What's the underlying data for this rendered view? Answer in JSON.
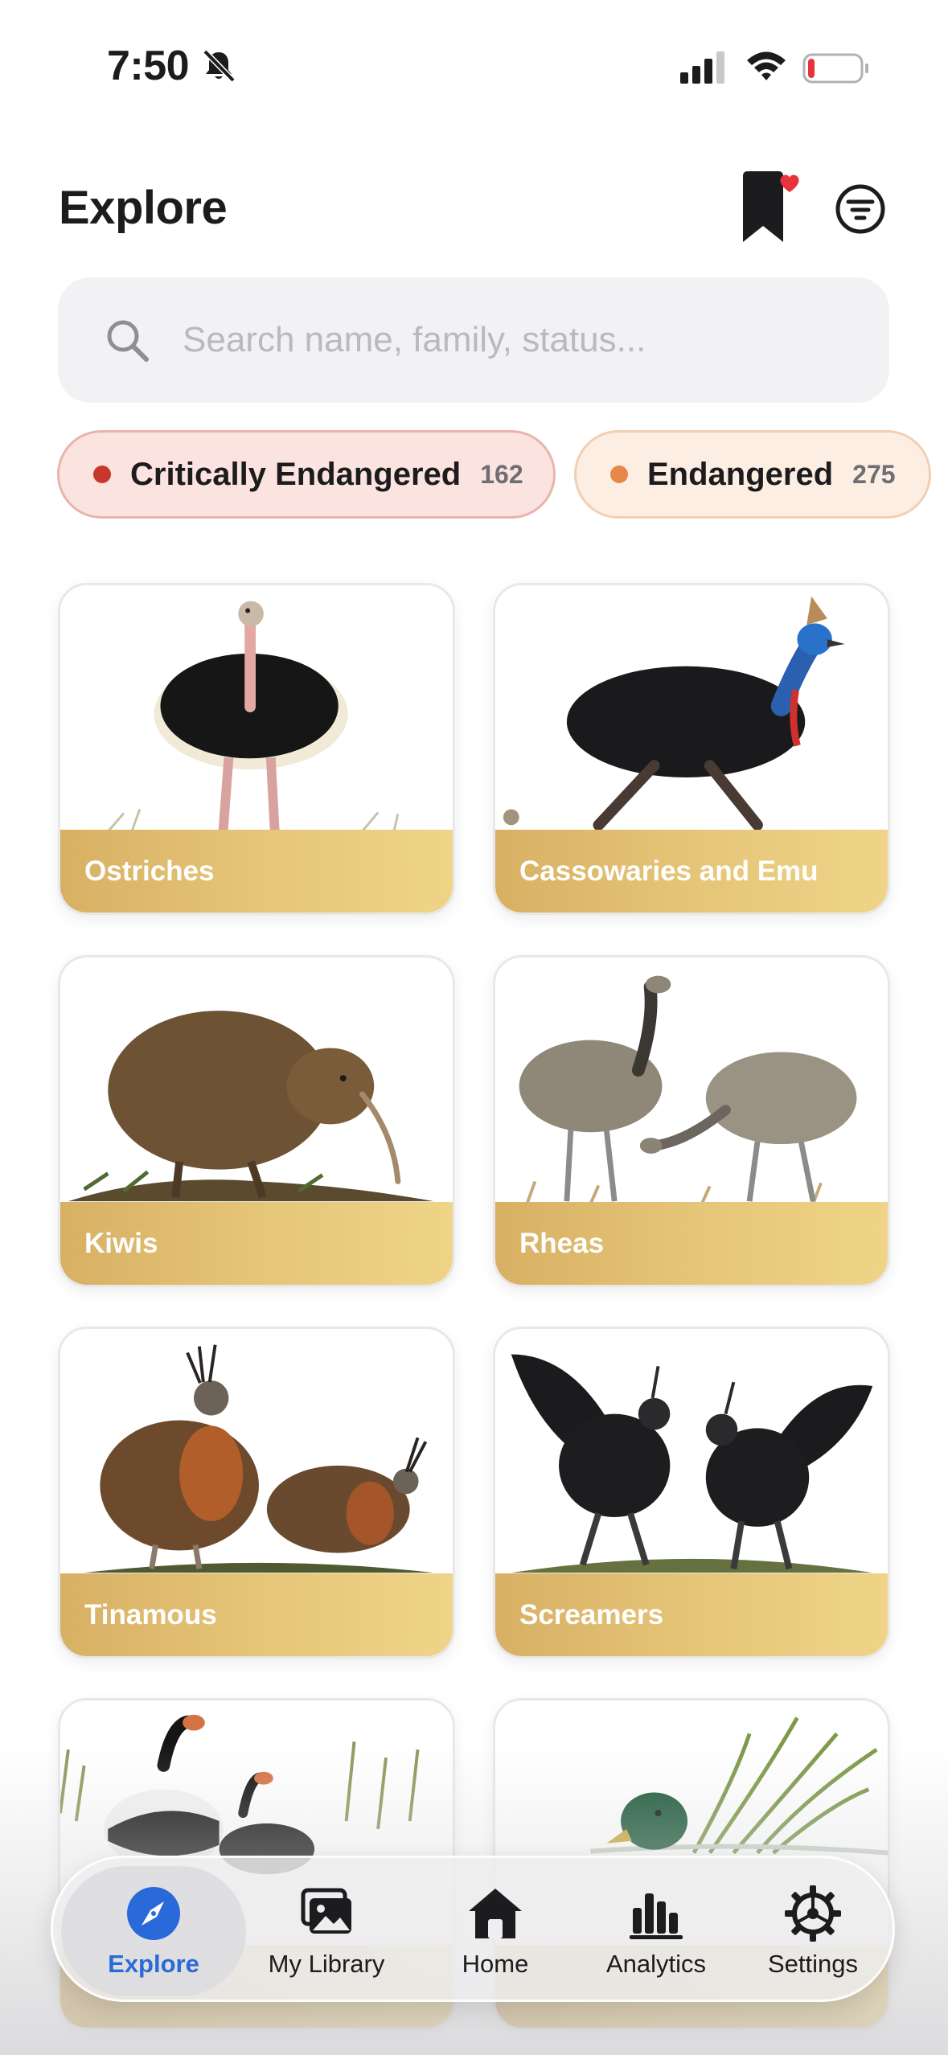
{
  "status_bar": {
    "time": "7:50",
    "icons": [
      "bell-slash-icon",
      "signal-icon",
      "wifi-icon",
      "battery-icon"
    ],
    "battery_level": 0.1
  },
  "header": {
    "title": "Explore",
    "bookmark_icon": "bookmark-heart-icon",
    "filter_icon": "filter-circle-icon"
  },
  "search": {
    "placeholder": "Search name, family, status..."
  },
  "chips": [
    {
      "label": "Critically Endangered",
      "count": "162",
      "dot_color": "#c8372c"
    },
    {
      "label": "Endangered",
      "count": "275",
      "dot_color": "#e8874a"
    }
  ],
  "cards": [
    {
      "label": "Ostriches"
    },
    {
      "label": "Cassowaries and Emu"
    },
    {
      "label": "Kiwis"
    },
    {
      "label": "Rheas"
    },
    {
      "label": "Tinamous"
    },
    {
      "label": "Screamers"
    },
    {
      "label": ""
    },
    {
      "label": ""
    }
  ],
  "tab_bar": {
    "tabs": [
      {
        "label": "Explore",
        "icon": "compass-icon",
        "active": true
      },
      {
        "label": "My Library",
        "icon": "photo-stack-icon",
        "active": false
      },
      {
        "label": "Home",
        "icon": "house-icon",
        "active": false
      },
      {
        "label": "Analytics",
        "icon": "bar-chart-icon",
        "active": false
      },
      {
        "label": "Settings",
        "icon": "gear-icon",
        "active": false
      }
    ]
  },
  "colors": {
    "accent": "#2a6ad8",
    "card_band_start": "#d8b064",
    "card_band_end": "#efd488",
    "critically_endangered": "#c8372c",
    "endangered": "#e8874a",
    "notification": "#e8333a"
  }
}
